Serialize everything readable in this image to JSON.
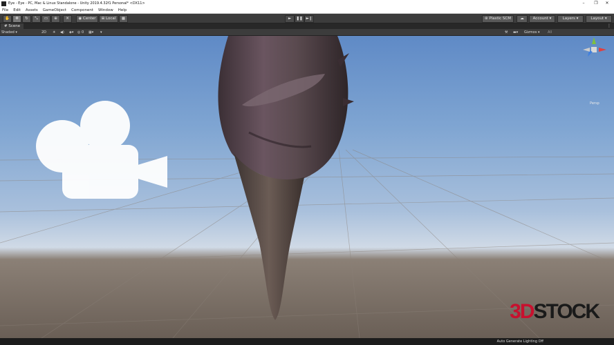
{
  "window": {
    "title": "Eye - Eye - PC, Mac & Linux Standalone - Unity 2019.4.32f1 Personal* <DX11>",
    "minimize": "–",
    "maximize": "❐",
    "close": "✕"
  },
  "menu": [
    "File",
    "Edit",
    "Assets",
    "GameObject",
    "Component",
    "Window",
    "Help"
  ],
  "toolbar": {
    "pivot_label": "Center",
    "space_label": "Local",
    "play_icon": "►",
    "pause_icon": "❚❚",
    "step_icon": "►❙",
    "plastic_label": "Plastic SCM",
    "account_label": "Account",
    "layers_label": "Layers",
    "layout_label": "Layout"
  },
  "tabs": {
    "scene_label": "Scene"
  },
  "scene_toolbar": {
    "shading_mode": "Shaded",
    "mode_2d": "2D",
    "gizmos_label": "Gizmos",
    "search_placeholder": "All"
  },
  "gizmo": {
    "projection_label": "Persp"
  },
  "status": {
    "lighting": "Auto Generate Lighting Off"
  },
  "watermark": {
    "part1": "3D",
    "part2": "STOCK"
  },
  "colors": {
    "toolbar_bg": "#3c3c3c",
    "titlebar_bg": "#ffffff",
    "sky_top": "#5f8ac6",
    "ground": "#6a5f56",
    "watermark_red": "#c8102e"
  }
}
